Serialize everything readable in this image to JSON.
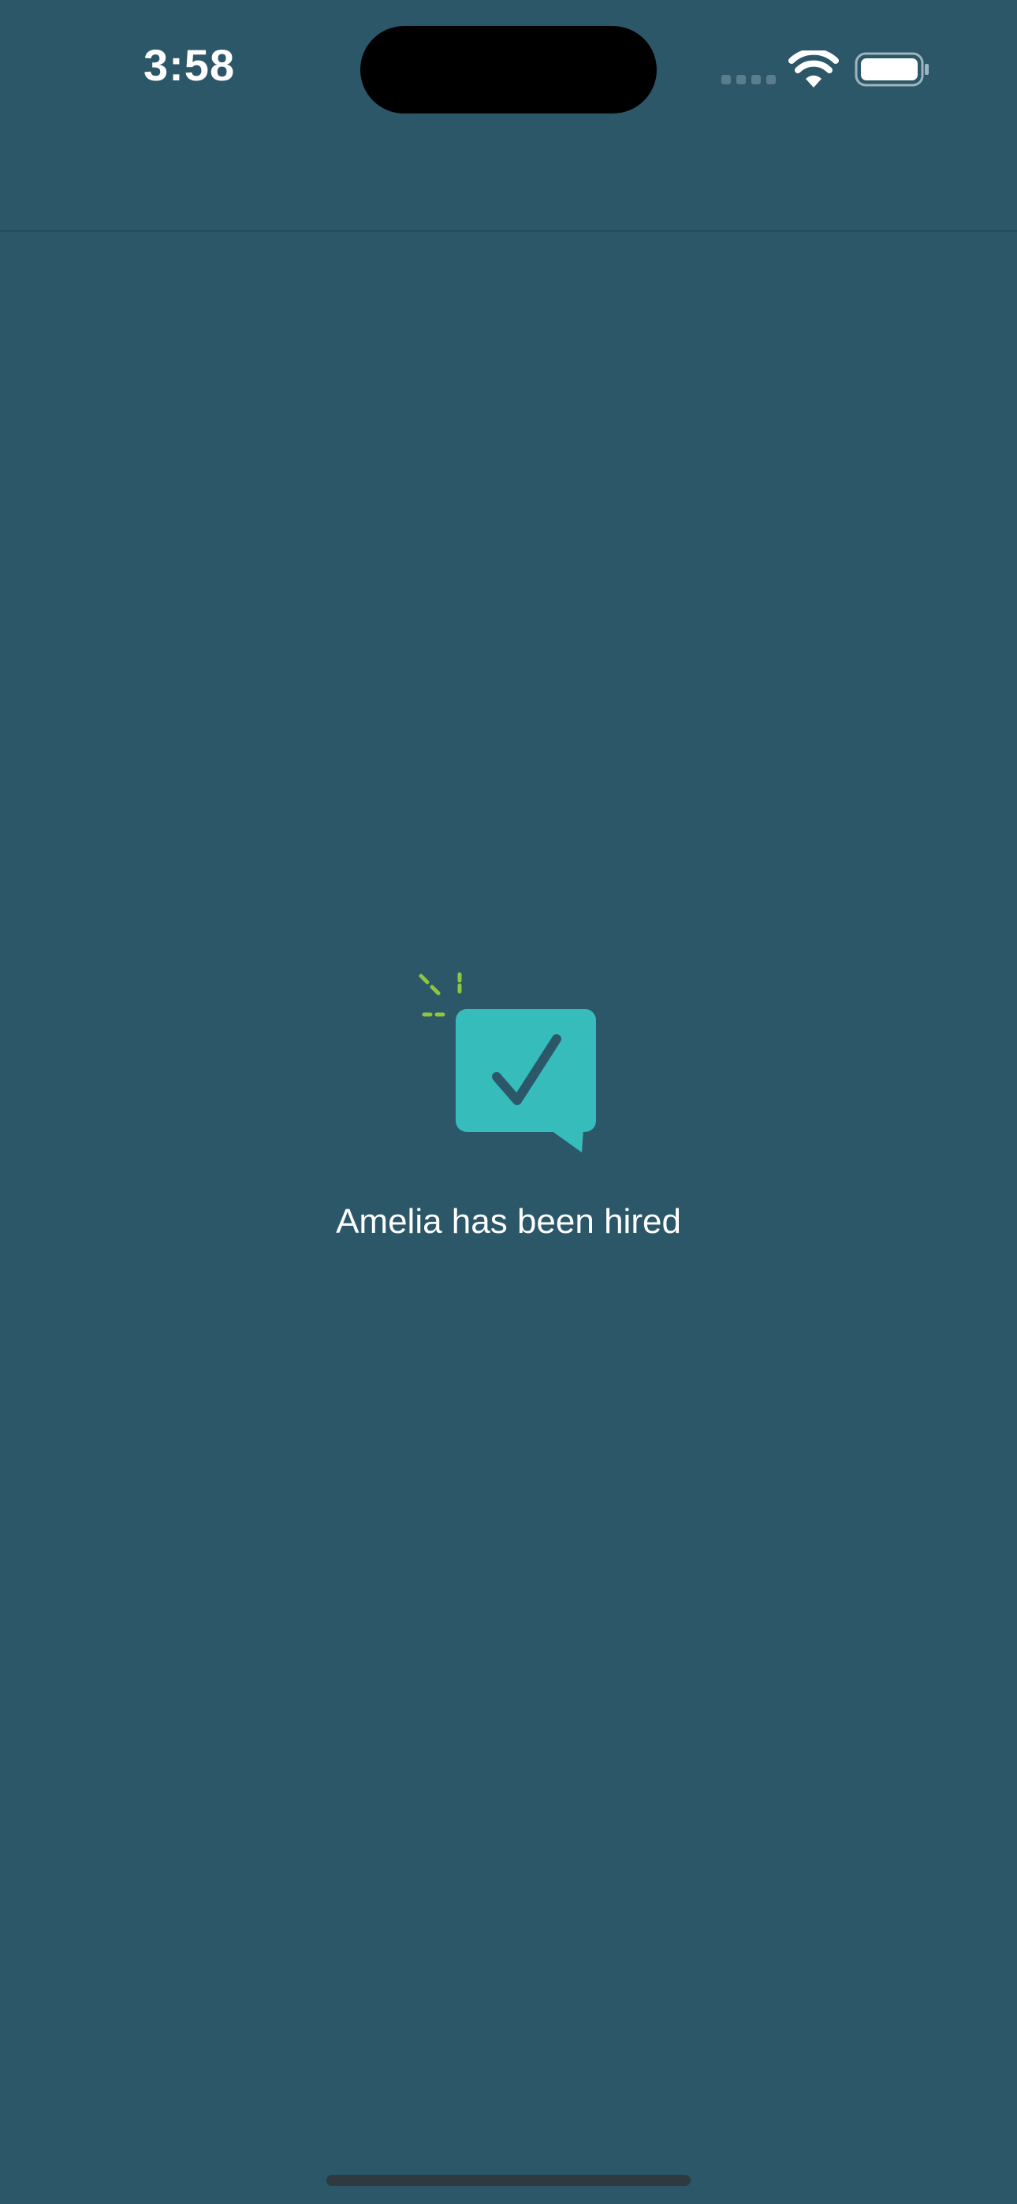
{
  "status_bar": {
    "time": "3:58"
  },
  "main": {
    "message": "Amelia has been hired",
    "icon": "speech-bubble-checkmark-icon"
  },
  "colors": {
    "background": "#2b5769",
    "bubble": "#37bcbc",
    "checkmark": "#2b5769",
    "sparkle": "#8dc63f",
    "text": "#ffffff"
  }
}
